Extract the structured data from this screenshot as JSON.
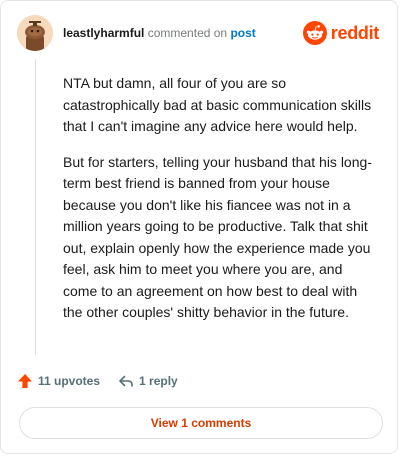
{
  "comment": {
    "author": "leastlyharmful",
    "action_text": "commented on",
    "post_link": "post",
    "paragraphs": [
      "NTA but damn, all four of you are so catastrophically bad at basic communication skills that I can't imagine any advice here would help.",
      "But for starters, telling your husband that his long-term best friend is banned from your house because you don't like his fiancee was not in a million years going to be productive. Talk that shit out, explain openly how the experience made you feel, ask him to meet you where you are, and come to an agreement on how best to deal with the other couples' shitty behavior in the future."
    ]
  },
  "brand": {
    "name": "reddit",
    "icon": "reddit-snoo-icon",
    "color": "#ff4500"
  },
  "actions": {
    "upvotes_label": "11 upvotes",
    "upvote_icon": "upvote-arrow-icon",
    "upvote_color": "#ff4500",
    "reply_label": "1 reply",
    "reply_icon": "reply-arrow-icon"
  },
  "view_comments": {
    "label": "View 1 comments",
    "color": "#d93a00"
  }
}
